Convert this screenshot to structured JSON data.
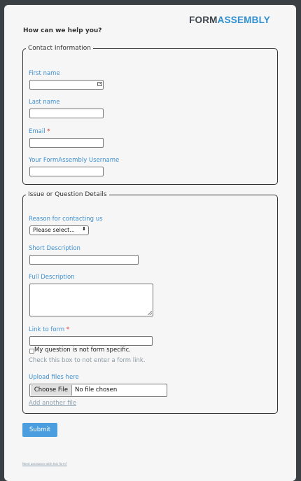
{
  "brand": {
    "logo_part1": "FORM",
    "logo_part2": "ASSEMBLY"
  },
  "form": {
    "heading": "How can we help you?",
    "contact": {
      "legend": "Contact Information",
      "first_name_label": "First name",
      "last_name_label": "Last name",
      "email_label": "Email",
      "email_required": "*",
      "username_label": "Your FormAssembly Username"
    },
    "issue": {
      "legend": "Issue or Question Details",
      "reason_label": "Reason for contacting us",
      "reason_value": "Please select...",
      "short_label": "Short Description",
      "full_label": "Full Description",
      "link_label": "Link to form",
      "link_required": "*",
      "checkbox_label": "My question is not form specific.",
      "hint": "Check this box to not enter a form link.",
      "upload_label": "Upload files here",
      "choose_file": "Choose File",
      "no_file": "No file chosen",
      "add_file": "Add another file"
    },
    "submit_label": "Submit",
    "footer_link": "Need assistance with this form?"
  },
  "colors": {
    "label": "#3f8fcf",
    "submit": "#4a9ee0",
    "required": "#d33",
    "logo_dark": "#3d464e",
    "logo_blue": "#2f8fd0"
  }
}
